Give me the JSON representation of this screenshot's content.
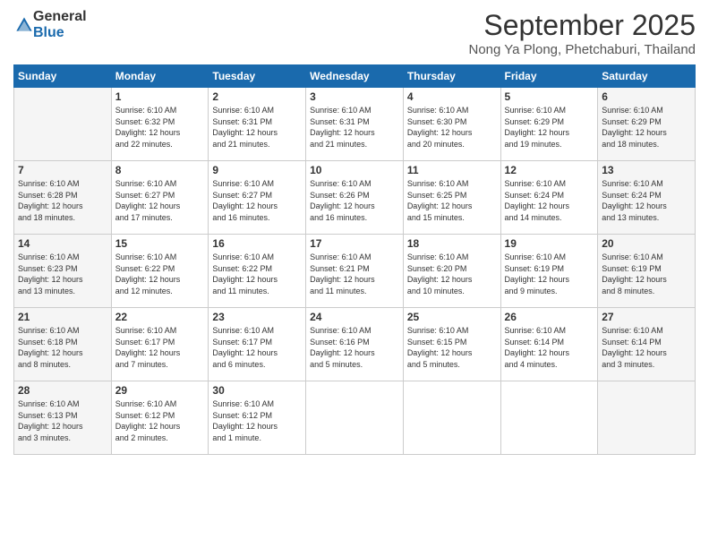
{
  "logo": {
    "general": "General",
    "blue": "Blue"
  },
  "title": "September 2025",
  "location": "Nong Ya Plong, Phetchaburi, Thailand",
  "headers": [
    "Sunday",
    "Monday",
    "Tuesday",
    "Wednesday",
    "Thursday",
    "Friday",
    "Saturday"
  ],
  "weeks": [
    [
      {
        "day": "",
        "info": ""
      },
      {
        "day": "1",
        "info": "Sunrise: 6:10 AM\nSunset: 6:32 PM\nDaylight: 12 hours\nand 22 minutes."
      },
      {
        "day": "2",
        "info": "Sunrise: 6:10 AM\nSunset: 6:31 PM\nDaylight: 12 hours\nand 21 minutes."
      },
      {
        "day": "3",
        "info": "Sunrise: 6:10 AM\nSunset: 6:31 PM\nDaylight: 12 hours\nand 21 minutes."
      },
      {
        "day": "4",
        "info": "Sunrise: 6:10 AM\nSunset: 6:30 PM\nDaylight: 12 hours\nand 20 minutes."
      },
      {
        "day": "5",
        "info": "Sunrise: 6:10 AM\nSunset: 6:29 PM\nDaylight: 12 hours\nand 19 minutes."
      },
      {
        "day": "6",
        "info": "Sunrise: 6:10 AM\nSunset: 6:29 PM\nDaylight: 12 hours\nand 18 minutes."
      }
    ],
    [
      {
        "day": "7",
        "info": "Sunrise: 6:10 AM\nSunset: 6:28 PM\nDaylight: 12 hours\nand 18 minutes."
      },
      {
        "day": "8",
        "info": "Sunrise: 6:10 AM\nSunset: 6:27 PM\nDaylight: 12 hours\nand 17 minutes."
      },
      {
        "day": "9",
        "info": "Sunrise: 6:10 AM\nSunset: 6:27 PM\nDaylight: 12 hours\nand 16 minutes."
      },
      {
        "day": "10",
        "info": "Sunrise: 6:10 AM\nSunset: 6:26 PM\nDaylight: 12 hours\nand 16 minutes."
      },
      {
        "day": "11",
        "info": "Sunrise: 6:10 AM\nSunset: 6:25 PM\nDaylight: 12 hours\nand 15 minutes."
      },
      {
        "day": "12",
        "info": "Sunrise: 6:10 AM\nSunset: 6:24 PM\nDaylight: 12 hours\nand 14 minutes."
      },
      {
        "day": "13",
        "info": "Sunrise: 6:10 AM\nSunset: 6:24 PM\nDaylight: 12 hours\nand 13 minutes."
      }
    ],
    [
      {
        "day": "14",
        "info": "Sunrise: 6:10 AM\nSunset: 6:23 PM\nDaylight: 12 hours\nand 13 minutes."
      },
      {
        "day": "15",
        "info": "Sunrise: 6:10 AM\nSunset: 6:22 PM\nDaylight: 12 hours\nand 12 minutes."
      },
      {
        "day": "16",
        "info": "Sunrise: 6:10 AM\nSunset: 6:22 PM\nDaylight: 12 hours\nand 11 minutes."
      },
      {
        "day": "17",
        "info": "Sunrise: 6:10 AM\nSunset: 6:21 PM\nDaylight: 12 hours\nand 11 minutes."
      },
      {
        "day": "18",
        "info": "Sunrise: 6:10 AM\nSunset: 6:20 PM\nDaylight: 12 hours\nand 10 minutes."
      },
      {
        "day": "19",
        "info": "Sunrise: 6:10 AM\nSunset: 6:19 PM\nDaylight: 12 hours\nand 9 minutes."
      },
      {
        "day": "20",
        "info": "Sunrise: 6:10 AM\nSunset: 6:19 PM\nDaylight: 12 hours\nand 8 minutes."
      }
    ],
    [
      {
        "day": "21",
        "info": "Sunrise: 6:10 AM\nSunset: 6:18 PM\nDaylight: 12 hours\nand 8 minutes."
      },
      {
        "day": "22",
        "info": "Sunrise: 6:10 AM\nSunset: 6:17 PM\nDaylight: 12 hours\nand 7 minutes."
      },
      {
        "day": "23",
        "info": "Sunrise: 6:10 AM\nSunset: 6:17 PM\nDaylight: 12 hours\nand 6 minutes."
      },
      {
        "day": "24",
        "info": "Sunrise: 6:10 AM\nSunset: 6:16 PM\nDaylight: 12 hours\nand 5 minutes."
      },
      {
        "day": "25",
        "info": "Sunrise: 6:10 AM\nSunset: 6:15 PM\nDaylight: 12 hours\nand 5 minutes."
      },
      {
        "day": "26",
        "info": "Sunrise: 6:10 AM\nSunset: 6:14 PM\nDaylight: 12 hours\nand 4 minutes."
      },
      {
        "day": "27",
        "info": "Sunrise: 6:10 AM\nSunset: 6:14 PM\nDaylight: 12 hours\nand 3 minutes."
      }
    ],
    [
      {
        "day": "28",
        "info": "Sunrise: 6:10 AM\nSunset: 6:13 PM\nDaylight: 12 hours\nand 3 minutes."
      },
      {
        "day": "29",
        "info": "Sunrise: 6:10 AM\nSunset: 6:12 PM\nDaylight: 12 hours\nand 2 minutes."
      },
      {
        "day": "30",
        "info": "Sunrise: 6:10 AM\nSunset: 6:12 PM\nDaylight: 12 hours\nand 1 minute."
      },
      {
        "day": "",
        "info": ""
      },
      {
        "day": "",
        "info": ""
      },
      {
        "day": "",
        "info": ""
      },
      {
        "day": "",
        "info": ""
      }
    ]
  ]
}
